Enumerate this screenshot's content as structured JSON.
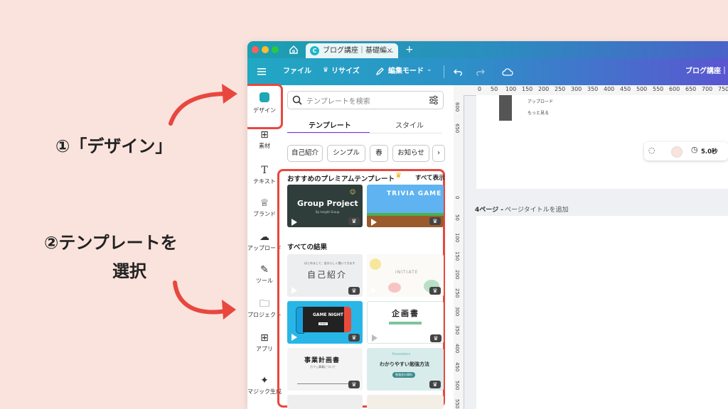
{
  "annotations": {
    "step1": "①「デザイン」",
    "step2_line1": "②テンプレートを",
    "step2_line2": "選択"
  },
  "colors": {
    "accent": "#e8473f",
    "background": "#f9e3dc",
    "brand_teal": "#1c9fb1",
    "brand_purple": "#5a56d0"
  },
  "titlebar": {
    "home_icon": "home-icon",
    "tab_title": "ブログ講座｜基礎編...",
    "close_symbol": "×",
    "new_tab_symbol": "+"
  },
  "toolbar": {
    "menu_icon": "hamburger-icon",
    "file": "ファイル",
    "resize": "リサイズ",
    "edit_mode": "編集モード",
    "doc_title": "ブログ講座｜"
  },
  "rail": {
    "items": [
      {
        "label": "デザイン",
        "icon": "design-icon"
      },
      {
        "label": "素材",
        "icon": "elements-icon"
      },
      {
        "label": "テキスト",
        "icon": "text-icon"
      },
      {
        "label": "ブランド",
        "icon": "brand-icon"
      },
      {
        "label": "アップロード",
        "icon": "upload-icon"
      },
      {
        "label": "ツール",
        "icon": "tools-icon"
      },
      {
        "label": "プロジェクト",
        "icon": "folder-icon"
      },
      {
        "label": "アプリ",
        "icon": "apps-icon"
      },
      {
        "label": "マジック生成",
        "icon": "magic-icon"
      }
    ]
  },
  "panel": {
    "search_placeholder": "テンプレートを検索",
    "tabs": [
      "テンプレート",
      "スタイル"
    ],
    "chips": [
      "自己紹介",
      "シンプル",
      "春",
      "お知らせ"
    ],
    "premium_heading": "おすすめのプレミアムテンプレート",
    "see_all": "すべて表示",
    "results_heading": "すべての結果",
    "premium_thumbs": [
      {
        "title": "Group Project",
        "subtitle": "By Insight Group"
      },
      {
        "title": "TRIVIA GAME"
      }
    ],
    "result_thumbs": [
      {
        "title": "自己紹介",
        "subtitle": "はじめまして、自分らしく働いてきます"
      },
      {
        "title": "INITIATE"
      },
      {
        "title": "GAME NIGHT",
        "subtitle": "START"
      },
      {
        "title": "企画書"
      },
      {
        "title": "事業計画書",
        "subtitle": "カフェ事業について"
      },
      {
        "title": "わかりやすい勉強方法",
        "subtitle": "Presentation",
        "button": "勉強会の資料"
      }
    ]
  },
  "canvas": {
    "ruler_labels": [
      "0",
      "50",
      "100",
      "150",
      "200",
      "250",
      "300",
      "350",
      "400",
      "450",
      "500",
      "550",
      "600",
      "650",
      "700",
      "750"
    ],
    "vruler_labels": [
      "600",
      "650",
      "0",
      "50",
      "100",
      "150",
      "200",
      "250",
      "300",
      "350",
      "400",
      "450",
      "500",
      "550"
    ],
    "upload_label": "アップロード",
    "more_label": "もっと見る",
    "duration": "5.0秒",
    "page_label": "4ページ -",
    "page_title_hint": "ページタイトルを追加"
  }
}
